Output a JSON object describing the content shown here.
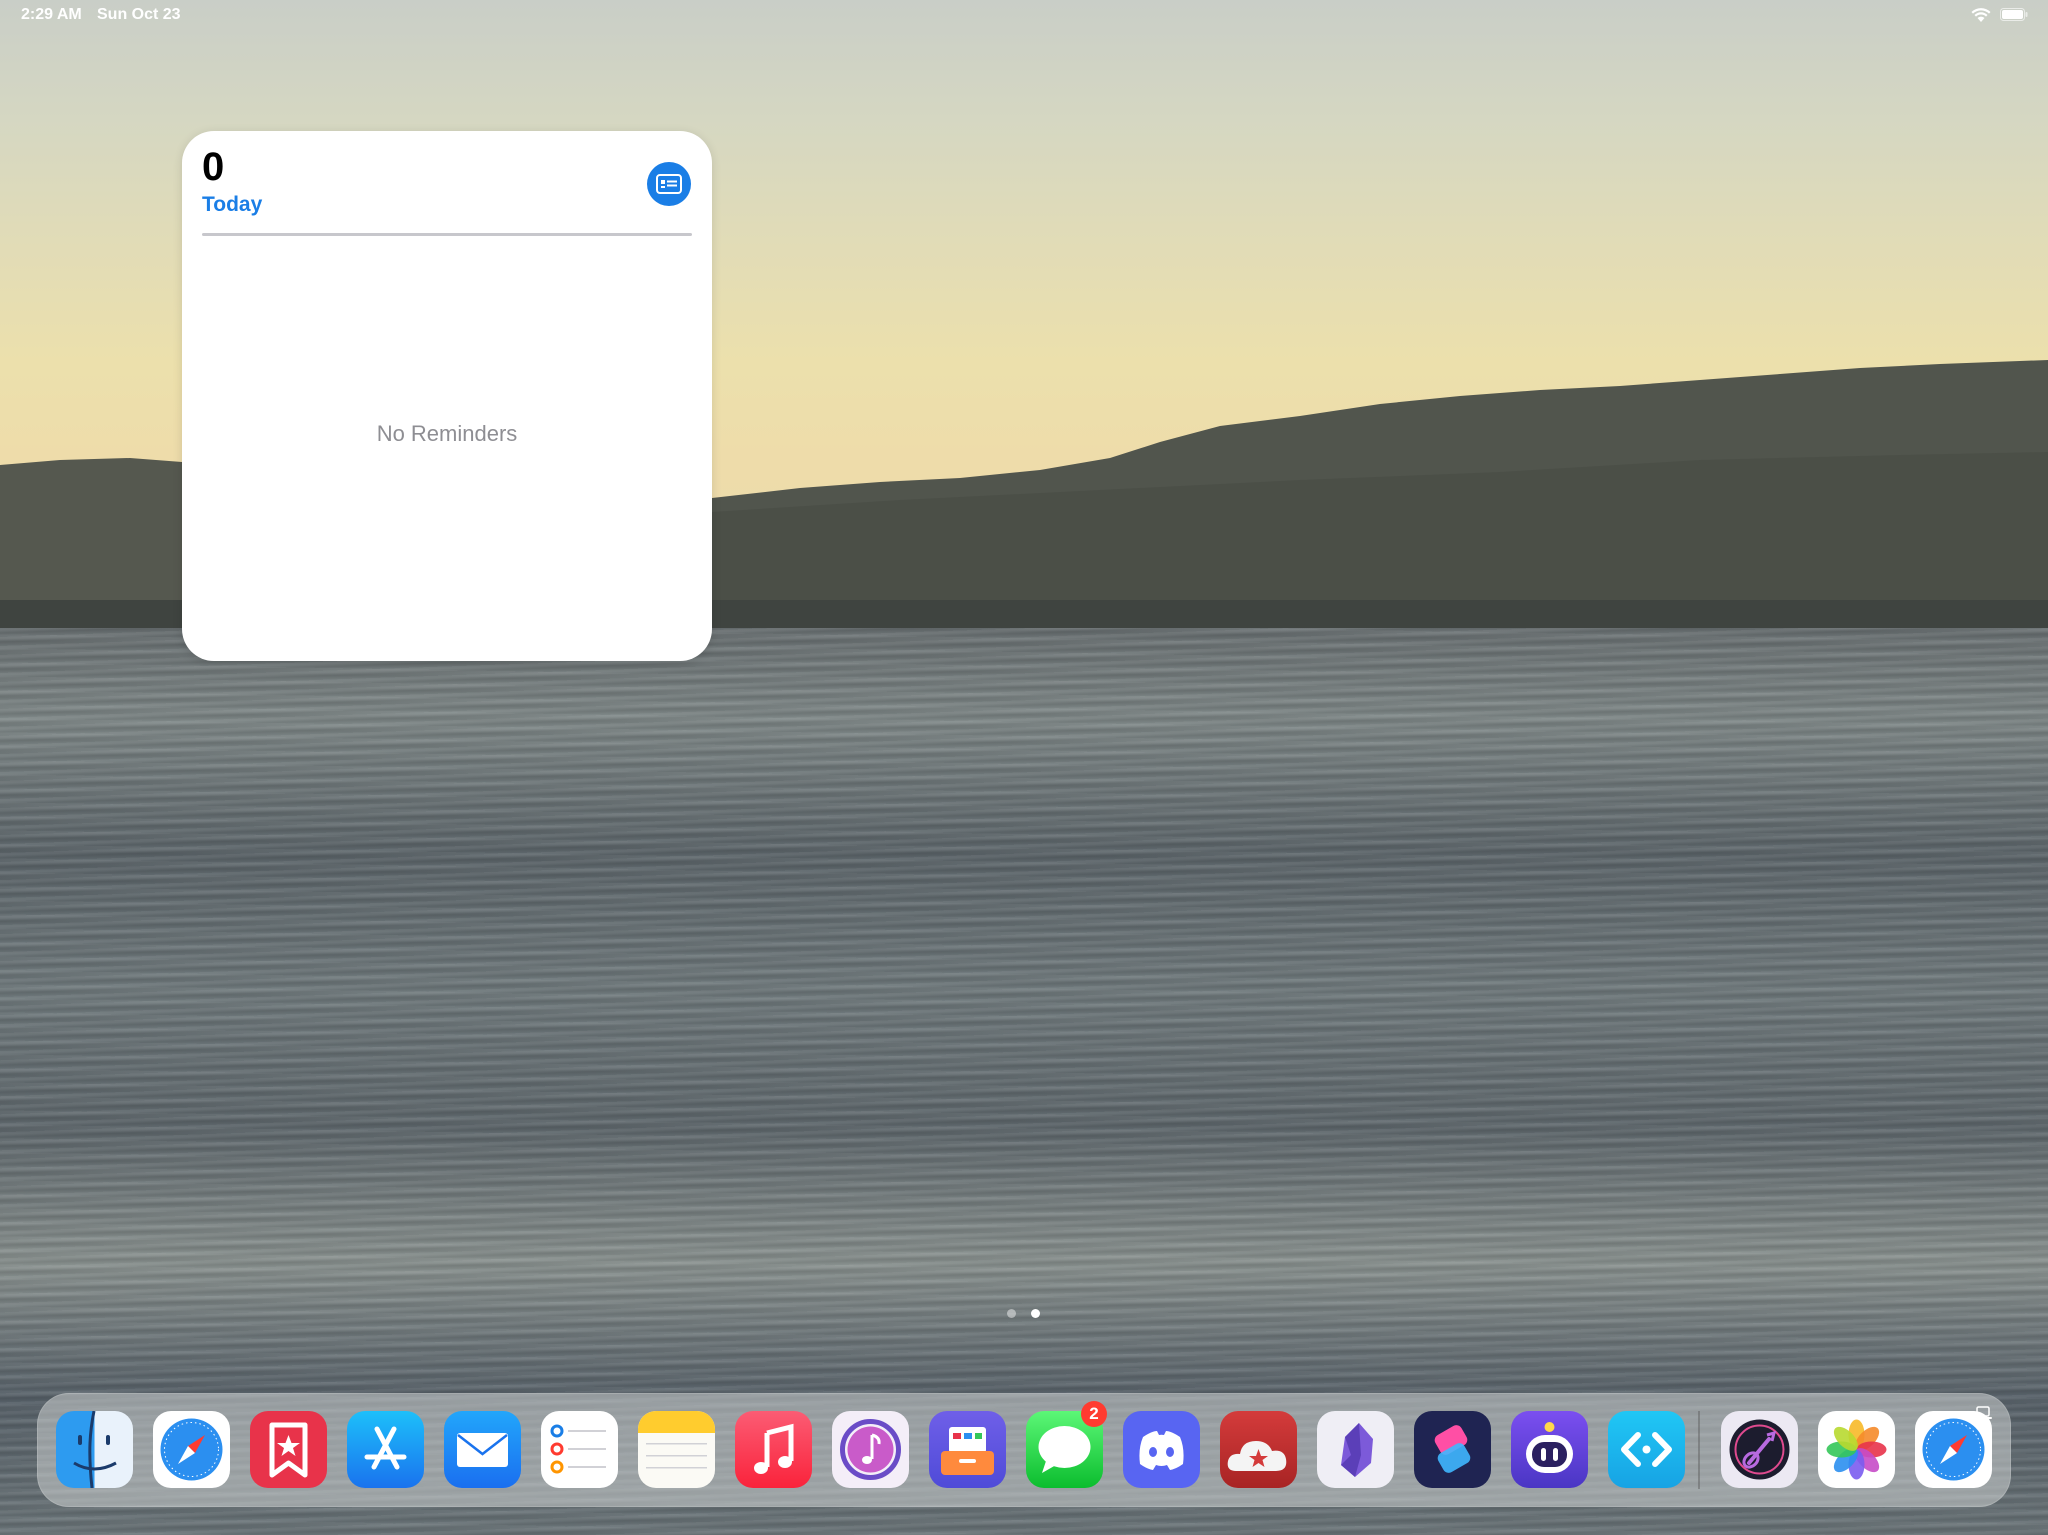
{
  "status_bar": {
    "time": "2:29 AM",
    "date": "Sun Oct 23",
    "wifi_icon": "wifi-icon",
    "battery_icon": "battery-icon"
  },
  "widget": {
    "app": "Reminders",
    "count": "0",
    "list_name": "Today",
    "empty_text": "No Reminders",
    "icon": "list-icon",
    "accent_color": "#1a7ee6"
  },
  "page_indicator": {
    "total": 2,
    "current": 2
  },
  "dock": {
    "apps": [
      {
        "name": "Finder",
        "icon": "finder-icon"
      },
      {
        "name": "Safari",
        "icon": "safari-icon"
      },
      {
        "name": "GoodLinks",
        "icon": "bookmark-star-icon"
      },
      {
        "name": "App Store",
        "icon": "app-store-icon"
      },
      {
        "name": "Mail",
        "icon": "mail-icon"
      },
      {
        "name": "Reminders",
        "icon": "reminders-icon"
      },
      {
        "name": "Notes",
        "icon": "notes-icon"
      },
      {
        "name": "Music",
        "icon": "music-icon"
      },
      {
        "name": "Music Player",
        "icon": "music-disc-icon"
      },
      {
        "name": "Archive",
        "icon": "archive-box-icon"
      },
      {
        "name": "Messages",
        "icon": "messages-icon",
        "badge": "2"
      },
      {
        "name": "Discord",
        "icon": "discord-icon"
      },
      {
        "name": "Cloud Star",
        "icon": "cloud-star-icon"
      },
      {
        "name": "Obsidian",
        "icon": "obsidian-icon"
      },
      {
        "name": "Shortcuts",
        "icon": "shortcuts-icon"
      },
      {
        "name": "Robot App",
        "icon": "robot-icon"
      },
      {
        "name": "Code Editor",
        "icon": "code-brackets-icon"
      }
    ],
    "recent_apps": [
      {
        "name": "Guitar App",
        "icon": "guitar-icon"
      },
      {
        "name": "Photos",
        "icon": "photos-icon"
      },
      {
        "name": "Safari",
        "icon": "safari-icon"
      }
    ]
  }
}
